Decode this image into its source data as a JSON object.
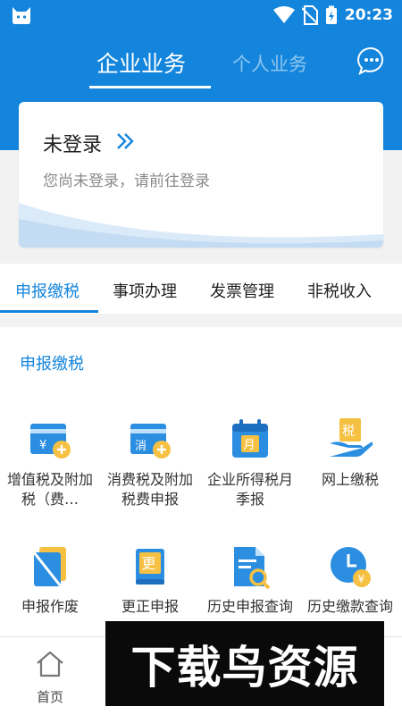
{
  "status_bar": {
    "time": "20:23",
    "icons": [
      "cat-icon",
      "wifi-icon",
      "no-sim-icon",
      "battery-charging-icon"
    ]
  },
  "header": {
    "tabs": [
      {
        "label": "企业业务",
        "active": true
      },
      {
        "label": "个人业务",
        "active": false
      }
    ],
    "message_icon": "chat-bubble-icon",
    "accent_color": "#1485dc"
  },
  "login_card": {
    "title": "未登录",
    "subtitle": "您尚未登录，请前往登录"
  },
  "category_tabs": [
    {
      "label": "申报缴税",
      "active": true
    },
    {
      "label": "事项办理",
      "active": false
    },
    {
      "label": "发票管理",
      "active": false
    },
    {
      "label": "非税收入",
      "active": false
    }
  ],
  "section": {
    "title": "申报缴税",
    "items": [
      {
        "label": "增值税及附加税（费…",
        "icon": "vat-card-icon"
      },
      {
        "label": "消费税及附加税费申报",
        "icon": "consumption-tax-card-icon"
      },
      {
        "label": "企业所得税月季报",
        "icon": "calendar-month-icon"
      },
      {
        "label": "网上缴税",
        "icon": "online-tax-payment-icon"
      },
      {
        "label": "申报作废",
        "icon": "void-declaration-icon"
      },
      {
        "label": "更正申报",
        "icon": "correction-declaration-icon"
      },
      {
        "label": "历史申报查询",
        "icon": "history-declaration-search-icon"
      },
      {
        "label": "历史缴款查询",
        "icon": "history-payment-clock-icon"
      }
    ]
  },
  "bottom_nav": {
    "items": [
      {
        "label": "首页",
        "icon": "home-icon"
      }
    ]
  },
  "watermark": {
    "text": "下载鸟资源"
  }
}
